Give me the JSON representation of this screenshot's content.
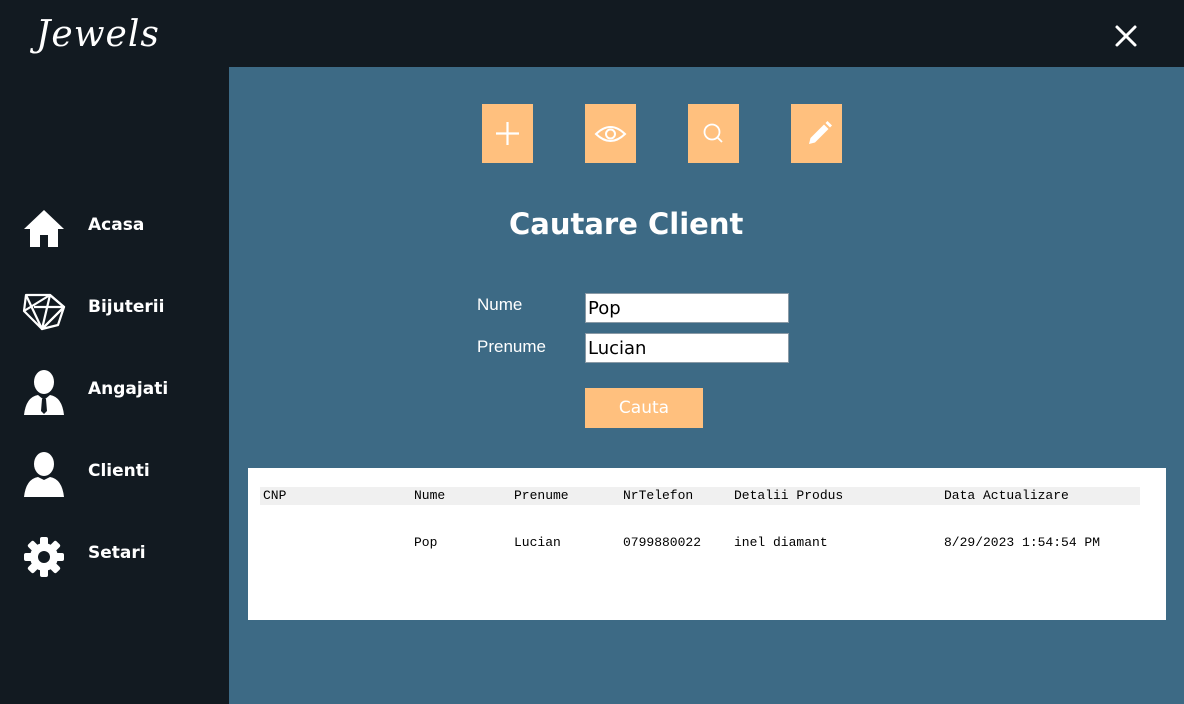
{
  "app": {
    "logo": "Jewels"
  },
  "sidebar": {
    "items": [
      {
        "label": "Acasa",
        "icon": "home-icon"
      },
      {
        "label": "Bijuterii",
        "icon": "diamond-icon"
      },
      {
        "label": "Angajati",
        "icon": "employee-icon"
      },
      {
        "label": "Clienti",
        "icon": "client-icon"
      },
      {
        "label": "Setari",
        "icon": "gear-icon"
      }
    ]
  },
  "toolbar": {
    "buttons": [
      "plus-icon",
      "eye-icon",
      "search-icon",
      "pencil-icon"
    ]
  },
  "main": {
    "title": "Cautare Client",
    "nume_label": "Nume",
    "nume_value": "Pop",
    "prenume_label": "Prenume",
    "prenume_value": "Lucian",
    "search_button": "Cauta"
  },
  "grid": {
    "columns": [
      "CNP",
      "Nume",
      "Prenume",
      "NrTelefon",
      "Detalii Produs",
      "Data Actualizare"
    ],
    "rows": [
      [
        "",
        "Pop",
        "Lucian",
        "0799880022",
        "inel diamant",
        "8/29/2023 1:54:54 PM"
      ]
    ]
  },
  "colors": {
    "dark": "#121a21",
    "main_bg": "#3d6a85",
    "accent": "#ffc07e"
  }
}
